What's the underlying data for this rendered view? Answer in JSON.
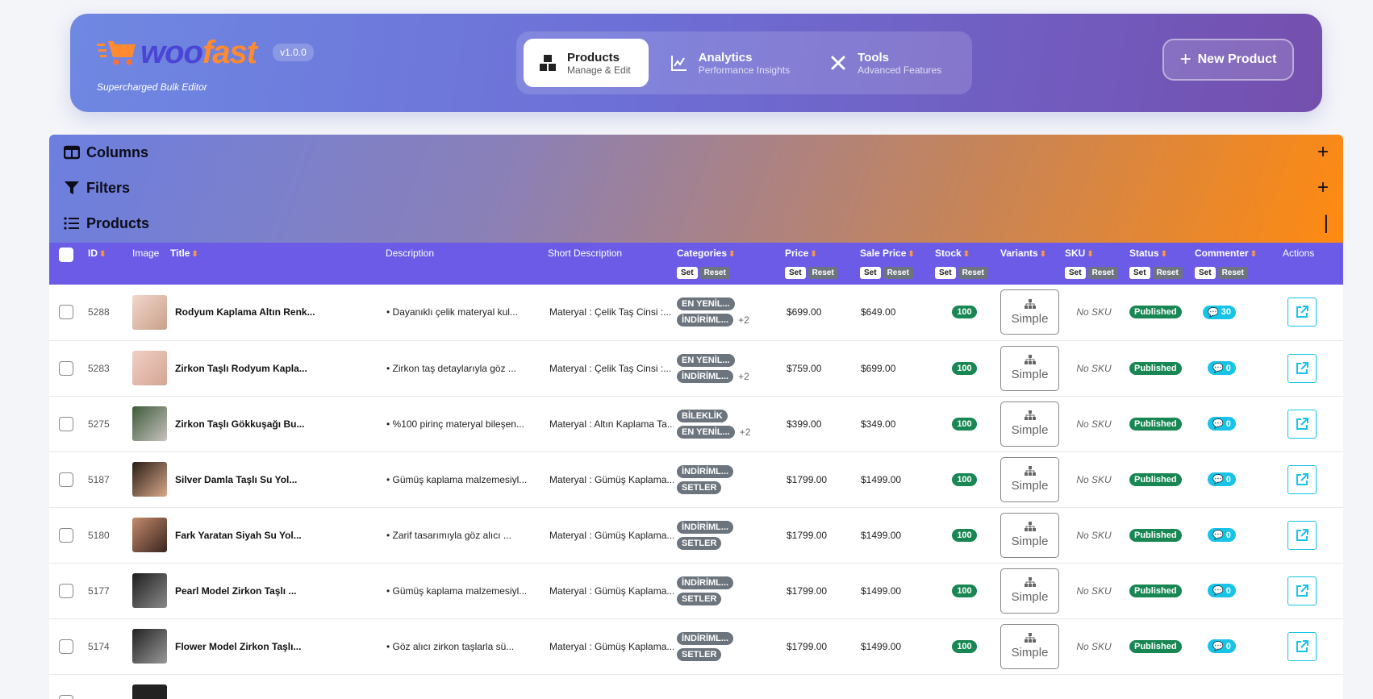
{
  "header": {
    "logo_woo": "woo",
    "logo_fast": "fast",
    "version": "v1.0.0",
    "tagline": "Supercharged Bulk Editor",
    "tabs": [
      {
        "label": "Products",
        "sub": "Manage & Edit",
        "icon": "boxes-icon",
        "active": true
      },
      {
        "label": "Analytics",
        "sub": "Performance Insights",
        "icon": "chart-line-icon",
        "active": false
      },
      {
        "label": "Tools",
        "sub": "Advanced Features",
        "icon": "tools-icon",
        "active": false
      }
    ],
    "new_product": "New Product"
  },
  "sections": [
    {
      "label": "Columns",
      "icon": "columns-icon",
      "toggle": "+"
    },
    {
      "label": "Filters",
      "icon": "filter-icon",
      "toggle": "+"
    },
    {
      "label": "Products",
      "icon": "list-icon",
      "toggle": "|"
    }
  ],
  "table": {
    "columns": [
      {
        "label": "",
        "sort": false,
        "setreset": false
      },
      {
        "label": "ID",
        "sort": true
      },
      {
        "label": "Image"
      },
      {
        "label": "Title",
        "sort": true
      },
      {
        "label": "Description"
      },
      {
        "label": "Short Description"
      },
      {
        "label": "Categories",
        "sort": true,
        "setreset": true
      },
      {
        "label": "Price",
        "sort": true,
        "setreset": true
      },
      {
        "label": "Sale Price",
        "sort": true,
        "setreset": true
      },
      {
        "label": "Stock",
        "sort": true,
        "setreset": true
      },
      {
        "label": "Variants",
        "sort": true
      },
      {
        "label": "SKU",
        "sort": true,
        "setreset": true
      },
      {
        "label": "Status",
        "sort": true,
        "setreset": true
      },
      {
        "label": "Commenter",
        "sort": true,
        "setreset": true
      },
      {
        "label": "Actions"
      }
    ],
    "set_label": "Set",
    "reset_label": "Reset",
    "sort_glyph": "⬍",
    "rows": [
      {
        "id": "5288",
        "title": "Rodyum Kaplama Altın Renk...",
        "desc": "• Dayanıklı çelik materyal kul...",
        "short": "Materyal :  Çelik Taş Cinsi :...",
        "cats": [
          "EN YENİL...",
          "İNDİRİML..."
        ],
        "more": "+2",
        "price": "$699.00",
        "sale": "$649.00",
        "stock": "100",
        "variant": "Simple",
        "sku": "No SKU",
        "status": "Published",
        "comments": "30",
        "img": [
          "#f3d6cc",
          "#c9a08a"
        ]
      },
      {
        "id": "5283",
        "title": "Zirkon Taşlı Rodyum Kapla...",
        "desc": "• Zirkon taş detaylarıyla göz ...",
        "short": "Materyal :  Çelik Taş Cinsi :...",
        "cats": [
          "EN YENİL...",
          "İNDİRİML..."
        ],
        "more": "+2",
        "price": "$759.00",
        "sale": "$699.00",
        "stock": "100",
        "variant": "Simple",
        "sku": "No SKU",
        "status": "Published",
        "comments": "0",
        "img": [
          "#f1cfc4",
          "#d4a594"
        ]
      },
      {
        "id": "5275",
        "title": "Zirkon Taşlı Gökkuşağı Bu...",
        "desc": "• %100 pirinç materyal bileşen...",
        "short": "Materyal :  Altın Kaplama Ta...",
        "cats": [
          "BİLEKLİK",
          "EN YENİL..."
        ],
        "more": "+2",
        "price": "$399.00",
        "sale": "$349.00",
        "stock": "100",
        "variant": "Simple",
        "sku": "No SKU",
        "status": "Published",
        "comments": "0",
        "img": [
          "#3d5a3a",
          "#c9c3bf"
        ]
      },
      {
        "id": "5187",
        "title": "Silver Damla Taşlı Su Yol...",
        "desc": "• Gümüş kaplama malzemesiyl...",
        "short": "Materyal :  Gümüş Kaplama...",
        "cats": [
          "İNDİRİML...",
          "SETLER"
        ],
        "more": "",
        "price": "$1799.00",
        "sale": "$1499.00",
        "stock": "100",
        "variant": "Simple",
        "sku": "No SKU",
        "status": "Published",
        "comments": "0",
        "img": [
          "#2a1d17",
          "#d9a98a"
        ]
      },
      {
        "id": "5180",
        "title": "Fark Yaratan Siyah Su Yol...",
        "desc": "• Zarif tasarımıyla göz alıcı ...",
        "short": "Materyal :  Gümüş Kaplama...",
        "cats": [
          "İNDİRİML...",
          "SETLER"
        ],
        "more": "",
        "price": "$1799.00",
        "sale": "$1499.00",
        "stock": "100",
        "variant": "Simple",
        "sku": "No SKU",
        "status": "Published",
        "comments": "0",
        "img": [
          "#c48a6a",
          "#3a2520"
        ]
      },
      {
        "id": "5177",
        "title": "Pearl Model Zirkon Taşlı ...",
        "desc": "• Gümüş kaplama malzemesiyl...",
        "short": "Materyal :  Gümüş Kaplama...",
        "cats": [
          "İNDİRİML...",
          "SETLER"
        ],
        "more": "",
        "price": "$1799.00",
        "sale": "$1499.00",
        "stock": "100",
        "variant": "Simple",
        "sku": "No SKU",
        "status": "Published",
        "comments": "0",
        "img": [
          "#1e1e1e",
          "#8a8a8a"
        ]
      },
      {
        "id": "5174",
        "title": "Flower Model Zirkon Taşlı...",
        "desc": "• Göz alıcı zirkon taşlarla sü...",
        "short": "Materyal :  Gümüş Kaplama...",
        "cats": [
          "İNDİRİML...",
          "SETLER"
        ],
        "more": "",
        "price": "$1799.00",
        "sale": "$1499.00",
        "stock": "100",
        "variant": "Simple",
        "sku": "No SKU",
        "status": "Published",
        "comments": "0",
        "img": [
          "#222",
          "#999"
        ]
      }
    ]
  }
}
